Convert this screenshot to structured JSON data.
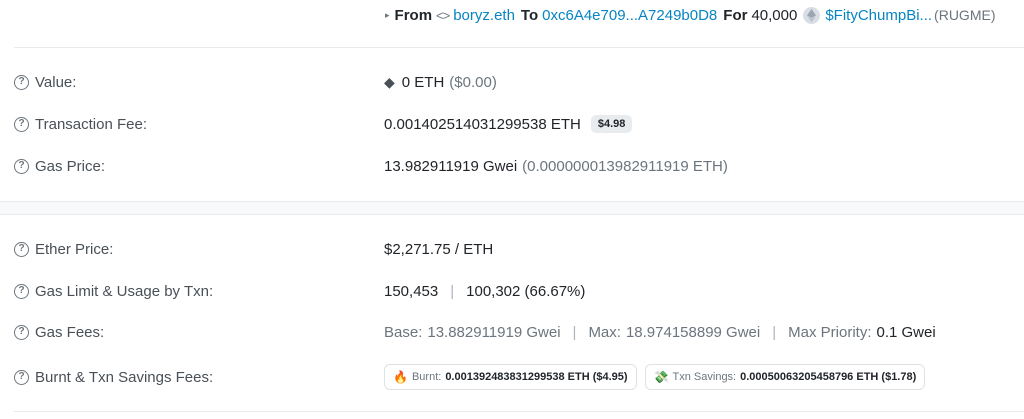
{
  "transfer": {
    "from_label": "From",
    "from_address": "boryz.eth",
    "to_label": "To",
    "to_address": "0xc6A4e709...A7249b0D8",
    "for_label": "For",
    "amount": "40,000",
    "token_name": "$FityChumpBi...",
    "token_symbol": "(RUGME)"
  },
  "details": {
    "value": {
      "label": "Value:",
      "amount": "0 ETH",
      "usd": "($0.00)"
    },
    "fee": {
      "label": "Transaction Fee:",
      "amount": "0.001402514031299538 ETH",
      "usd_badge": "$4.98"
    },
    "gas_price": {
      "label": "Gas Price:",
      "gwei": "13.982911919 Gwei",
      "eth": "(0.000000013982911919 ETH)"
    }
  },
  "more": {
    "ether_price": {
      "label": "Ether Price:",
      "value": "$2,271.75 / ETH"
    },
    "gas_limit": {
      "label": "Gas Limit & Usage by Txn:",
      "limit": "150,453",
      "sep": "|",
      "usage": "100,302 (66.67%)"
    },
    "gas_fees": {
      "label": "Gas Fees:",
      "base_label": "Base:",
      "base_value": "13.882911919 Gwei",
      "max_label": "Max:",
      "max_value": "18.974158899 Gwei",
      "priority_label": "Max Priority:",
      "priority_value": "0.1 Gwei",
      "sep": "|"
    },
    "burnt": {
      "label": "Burnt & Txn Savings Fees:",
      "burnt_label": "Burnt:",
      "burnt_value": "0.001392483831299538 ETH ($4.95)",
      "savings_label": "Txn Savings:",
      "savings_value": "0.00050063205458796 ETH ($1.78)"
    }
  },
  "icons": {
    "question": "?",
    "eth": "◆",
    "code": "<>",
    "triangle": "▸",
    "fire": "🔥",
    "money": "💸"
  },
  "colors": {
    "link": "#0784c3",
    "muted": "#6c757d",
    "border": "#e9ecef"
  }
}
